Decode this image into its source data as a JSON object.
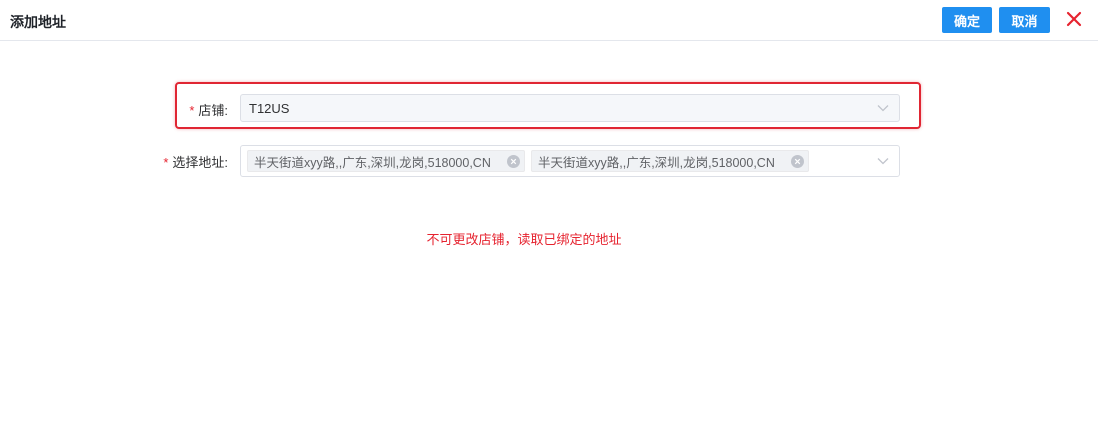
{
  "header": {
    "title": "添加地址",
    "confirm_label": "确定",
    "cancel_label": "取消"
  },
  "form": {
    "store": {
      "required_mark": "*",
      "label": "店铺:",
      "value": "T12US",
      "disabled": true
    },
    "address": {
      "required_mark": "*",
      "label": "选择地址:",
      "tags": [
        "半天街道xyy路,,广东,深圳,龙岗,518000,CN",
        "半天街道xyy路,,广东,深圳,龙岗,518000,CN"
      ]
    }
  },
  "notice": "不可更改店铺，读取已绑定的地址",
  "colors": {
    "primary": "#1f8ff0",
    "danger": "#e6232f",
    "highlight_border": "#e02633"
  },
  "icons": {
    "close": "close-icon",
    "chevron": "chevron-down-icon",
    "tag_remove": "tag-close-icon"
  }
}
